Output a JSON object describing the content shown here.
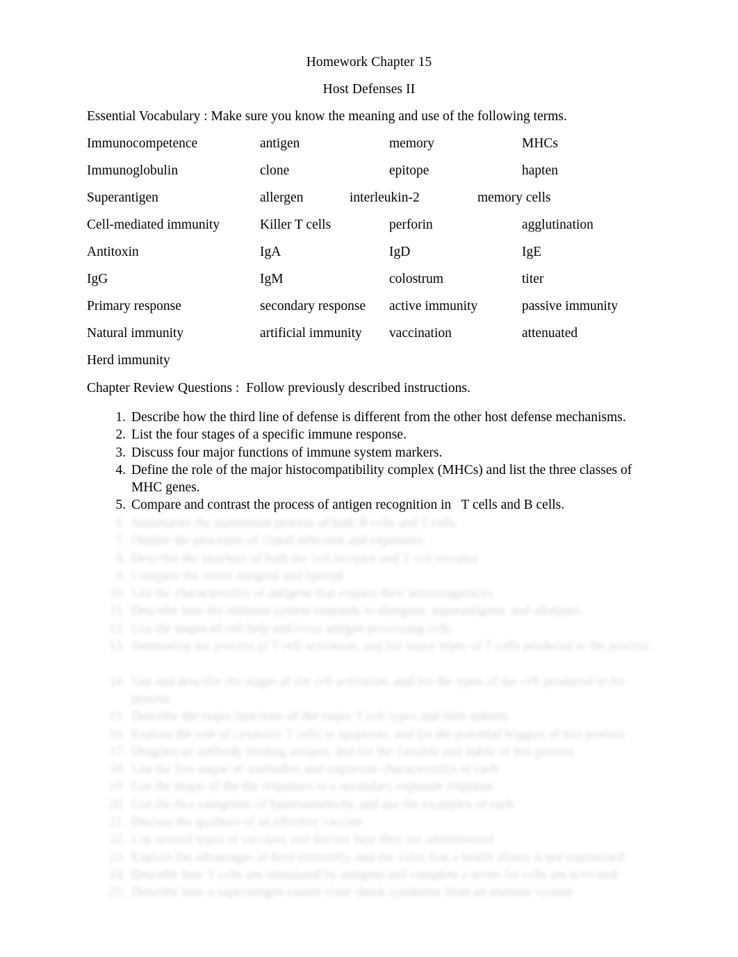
{
  "document": {
    "title_line_1": "Homework Chapter 15",
    "title_line_2": "Host Defenses II",
    "vocabulary_intro": "Essential Vocabulary : Make sure you know the meaning and use of the following terms.",
    "review_intro": "Chapter Review Questions :  Follow previously described instructions."
  },
  "vocabulary": {
    "rows": [
      {
        "col1": "Immunocompetence",
        "col2": "antigen",
        "col3": "memory",
        "col4": "MHCs"
      },
      {
        "col1": "Immunoglobulin",
        "col2": "clone",
        "col3": "epitope",
        "col4": "hapten"
      },
      {
        "col1": "Superantigen",
        "col2": "allergen",
        "col3": "interleukin-2",
        "col4": "memory cells"
      },
      {
        "col1": "Cell-mediated immunity",
        "col2": "Killer T cells",
        "col3": "perforin",
        "col4": "agglutination"
      },
      {
        "col1": "Antitoxin",
        "col2": "IgA",
        "col3": "IgD",
        "col4": "IgE"
      },
      {
        "col1": "IgG",
        "col2": "IgM",
        "col3": "colostrum",
        "col4": "titer"
      },
      {
        "col1": "Primary response",
        "col2": "secondary response",
        "col3": "active immunity",
        "col4": "passive immunity"
      },
      {
        "col1": "Natural immunity",
        "col2": "artificial immunity",
        "col3": "vaccination",
        "col4": "attenuated"
      },
      {
        "col1": "Herd immunity",
        "col2": "",
        "col3": "",
        "col4": ""
      }
    ]
  },
  "questions": [
    {
      "number": "1.",
      "text": "Describe how the third line of defense is different from the other host defense mechanisms."
    },
    {
      "number": "2.",
      "text": "List the four stages of a specific immune response."
    },
    {
      "number": "3.",
      "text": "Discuss four major functions of immune system markers."
    },
    {
      "number": "4.",
      "text": "Define the role of the major histocompatibility complex (MHCs) and list the three classes of MHC genes."
    },
    {
      "number": "5.",
      "text": "Compare and contrast the process of antigen recognition in   T cells and B cells."
    }
  ],
  "faded_questions": {
    "note": "Remaining numbered items are blurred and illegible in the source image.",
    "items": [
      {
        "number": "6.",
        "text": "Summarize the maturation process of both B cells and T cells"
      },
      {
        "number": "7.",
        "text": "Outline the processes of clonal selection and expansion"
      },
      {
        "number": "8.",
        "text": "Describe the structure of both the cell receptor and T cell receptor"
      },
      {
        "number": "9.",
        "text": "Compare the seven antigens and epitope"
      },
      {
        "number": "10.",
        "text": "List the characteristics of antigens that explain their immunogenicity"
      },
      {
        "number": "11.",
        "text": "Describe how the immune system responds to allergens, superantigens, and allotypes"
      },
      {
        "number": "12.",
        "text": "List the stages of cell help and cross antigen processing cells"
      },
      {
        "number": "13.",
        "text": "Summarize the process of T cell activation, and list major types of T cells produced in the process."
      },
      {
        "number": "14.",
        "text": "List and describe the stages of the cell activation, and list the types of the cell produced in the process."
      },
      {
        "number": "15.",
        "text": "Describe the major functions of the major T cell types and their subsets"
      },
      {
        "number": "16.",
        "text": "Explain the role of cytotoxic T cells in apoptosis, and list the potential triggers of this process"
      },
      {
        "number": "17.",
        "text": "Diagram an antibody binding antigen, and list the variable and stable of this process"
      },
      {
        "number": "18.",
        "text": "List the five major of antibodies and important characteristics of each"
      },
      {
        "number": "19.",
        "text": "List the major of the the responses to a secondary exposure response"
      },
      {
        "number": "20.",
        "text": "List the five categories of hypersensitivity, and use the examples of each"
      },
      {
        "number": "21.",
        "text": "Discuss the qualities of an effective vaccine"
      },
      {
        "number": "22.",
        "text": "List several types of vaccines and discuss how they are administered"
      },
      {
        "number": "23.",
        "text": "Explain the advantages of herd immunity, and the value that a health illness is not maintained"
      },
      {
        "number": "24.",
        "text": "Describe how T cells are stimulated by antigens and complete a series for cells are activated"
      },
      {
        "number": "25.",
        "text": "Describe how a superantigen causes toxic shock syndrome from an immune system"
      }
    ]
  }
}
